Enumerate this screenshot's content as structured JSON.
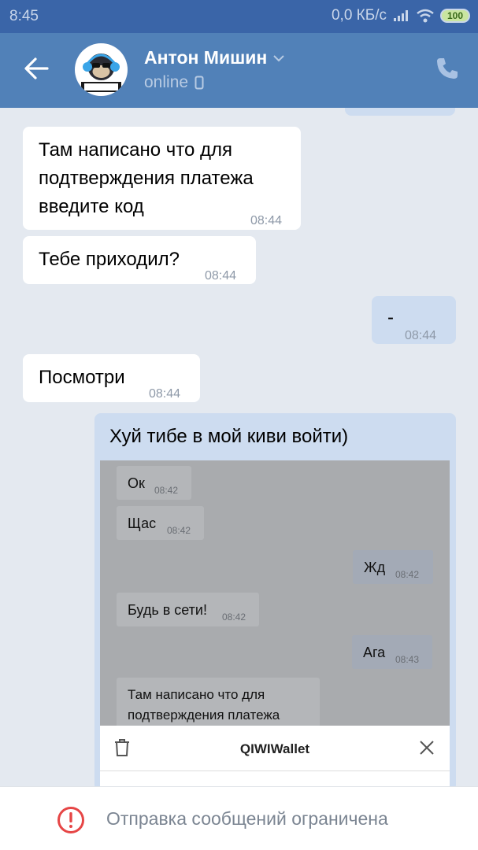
{
  "status_bar": {
    "time": "8:45",
    "network": "0,0 КБ/с",
    "battery": "100"
  },
  "header": {
    "name": "Антон Мишин",
    "status": "online"
  },
  "messages": [
    {
      "text1": "Там написано что для",
      "text2": "подтверждения платежа",
      "text3": "введите код",
      "time": "08:44"
    },
    {
      "text": "Тебе приходил?",
      "time": "08:44"
    },
    {
      "text": "-",
      "time": "08:44"
    },
    {
      "text": "Посмотри",
      "time": "08:44"
    },
    {
      "text": "Хуй тибе в мой киви войти)"
    }
  ],
  "screenshot_messages": [
    {
      "text": "Ок",
      "time": "08:42"
    },
    {
      "text": "Щас",
      "time": "08:42"
    },
    {
      "text": "Жд",
      "time": "08:42"
    },
    {
      "text": "Будь в сети!",
      "time": "08:42"
    },
    {
      "text": "Ага",
      "time": "08:43"
    },
    {
      "text1": "Там написано что для",
      "text2": "подтверждения платежа"
    }
  ],
  "qiwi_bar": {
    "title": "QIWIWallet"
  },
  "bottom_bar": {
    "message": "Отправка сообщений ограничена"
  },
  "colors": {
    "header": "#5181b8",
    "status_bar": "#3a65a8",
    "outgoing": "#cddcf0",
    "background": "#e4e9f0"
  }
}
